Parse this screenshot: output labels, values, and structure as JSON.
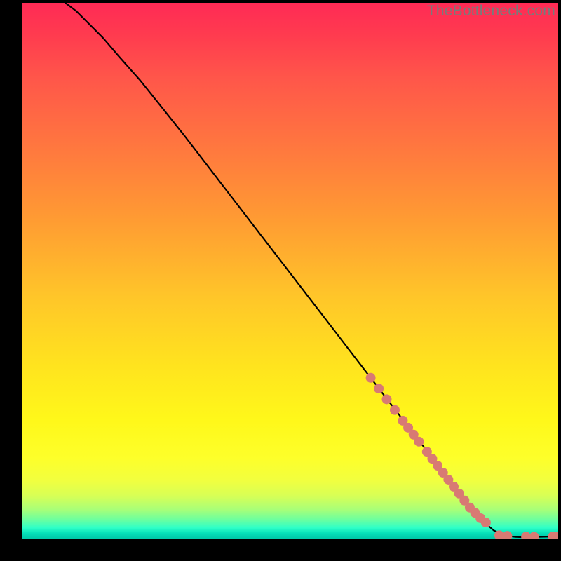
{
  "watermark": "TheBottleneck.com",
  "colors": {
    "curve": "#000000",
    "marker": "#d87a73",
    "background": "#000000"
  },
  "chart_data": {
    "type": "line",
    "title": "",
    "xlabel": "",
    "ylabel": "",
    "xlim": [
      0,
      100
    ],
    "ylim": [
      0,
      100
    ],
    "grid": false,
    "series": [
      {
        "name": "curve",
        "x": [
          8,
          10,
          12,
          15,
          18,
          22,
          26,
          30,
          35,
          40,
          45,
          50,
          55,
          60,
          65,
          70,
          75,
          80,
          82,
          84,
          86,
          88,
          90,
          92,
          94,
          96,
          98,
          100
        ],
        "y": [
          100,
          98.5,
          96.5,
          93.5,
          90,
          85.5,
          80.5,
          75.5,
          69,
          62.5,
          56,
          49.5,
          43,
          36.5,
          30,
          23.5,
          17,
          10.5,
          8,
          5.5,
          3.2,
          1.5,
          0.6,
          0.3,
          0.25,
          0.3,
          0.35,
          0.4
        ]
      }
    ],
    "markers": {
      "name": "dots",
      "x": [
        65,
        66.5,
        68,
        69.5,
        71,
        72,
        73,
        74,
        75.5,
        76.5,
        77.5,
        78.5,
        79.5,
        80.5,
        81.5,
        82.5,
        83.5,
        84.5,
        85.5,
        86.5,
        89,
        90.5,
        94,
        95.5,
        99,
        100
      ],
      "y": [
        30,
        28,
        26,
        24,
        22,
        20.7,
        19.4,
        18.1,
        16.2,
        14.9,
        13.6,
        12.3,
        11,
        9.7,
        8.4,
        7.1,
        5.8,
        4.8,
        3.8,
        3,
        0.6,
        0.5,
        0.35,
        0.35,
        0.4,
        0.4
      ]
    }
  }
}
